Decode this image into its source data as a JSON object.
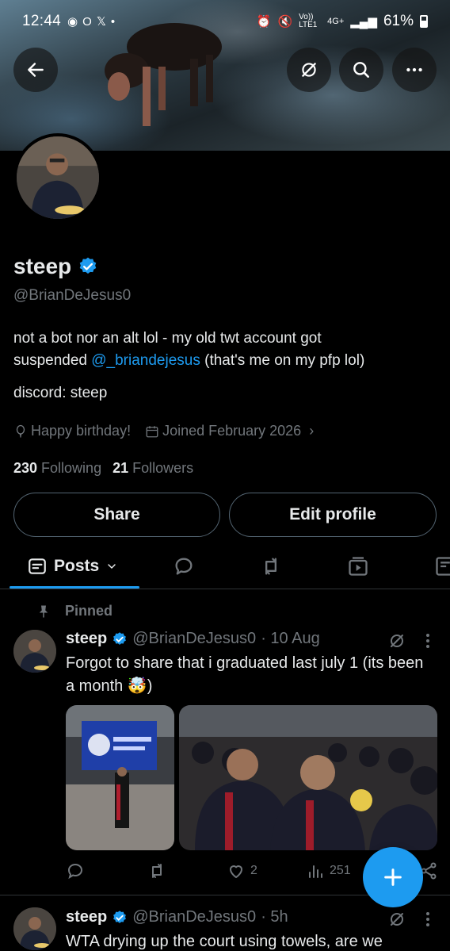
{
  "status_bar": {
    "time": "12:44",
    "battery": "61%",
    "network": "4G+",
    "volte": "Vo)) LTE1"
  },
  "profile": {
    "name": "steep",
    "handle": "@BrianDeJesus0",
    "bio_line1": "not a bot nor an alt lol - my old twt account got",
    "bio_line2_prefix": "suspended ",
    "bio_mention": "@_briandejesus",
    "bio_line2_suffix": " (that's me on my pfp lol)",
    "bio_discord": "discord: steep",
    "birthday": "Happy birthday!",
    "joined": "Joined February 2026",
    "following_count": "230",
    "following_label": "Following",
    "followers_count": "21",
    "followers_label": "Followers"
  },
  "buttons": {
    "share": "Share",
    "edit_profile": "Edit profile"
  },
  "tabs": {
    "posts": "Posts"
  },
  "pinned_label": "Pinned",
  "posts": [
    {
      "name": "steep",
      "handle": "@BrianDeJesus0",
      "time": "· 10 Aug",
      "text": "Forgot to share that i graduated last july 1 (its been a month 🤯)",
      "likes": "2",
      "views": "251"
    },
    {
      "name": "steep",
      "handle": "@BrianDeJesus0",
      "time": "· 5h",
      "text": "WTA drying up the court using towels, are we"
    }
  ],
  "colors": {
    "accent": "#1d9bf0",
    "background": "#000000",
    "text_primary": "#e7e9ea",
    "text_secondary": "#71767b",
    "border": "#536471"
  }
}
